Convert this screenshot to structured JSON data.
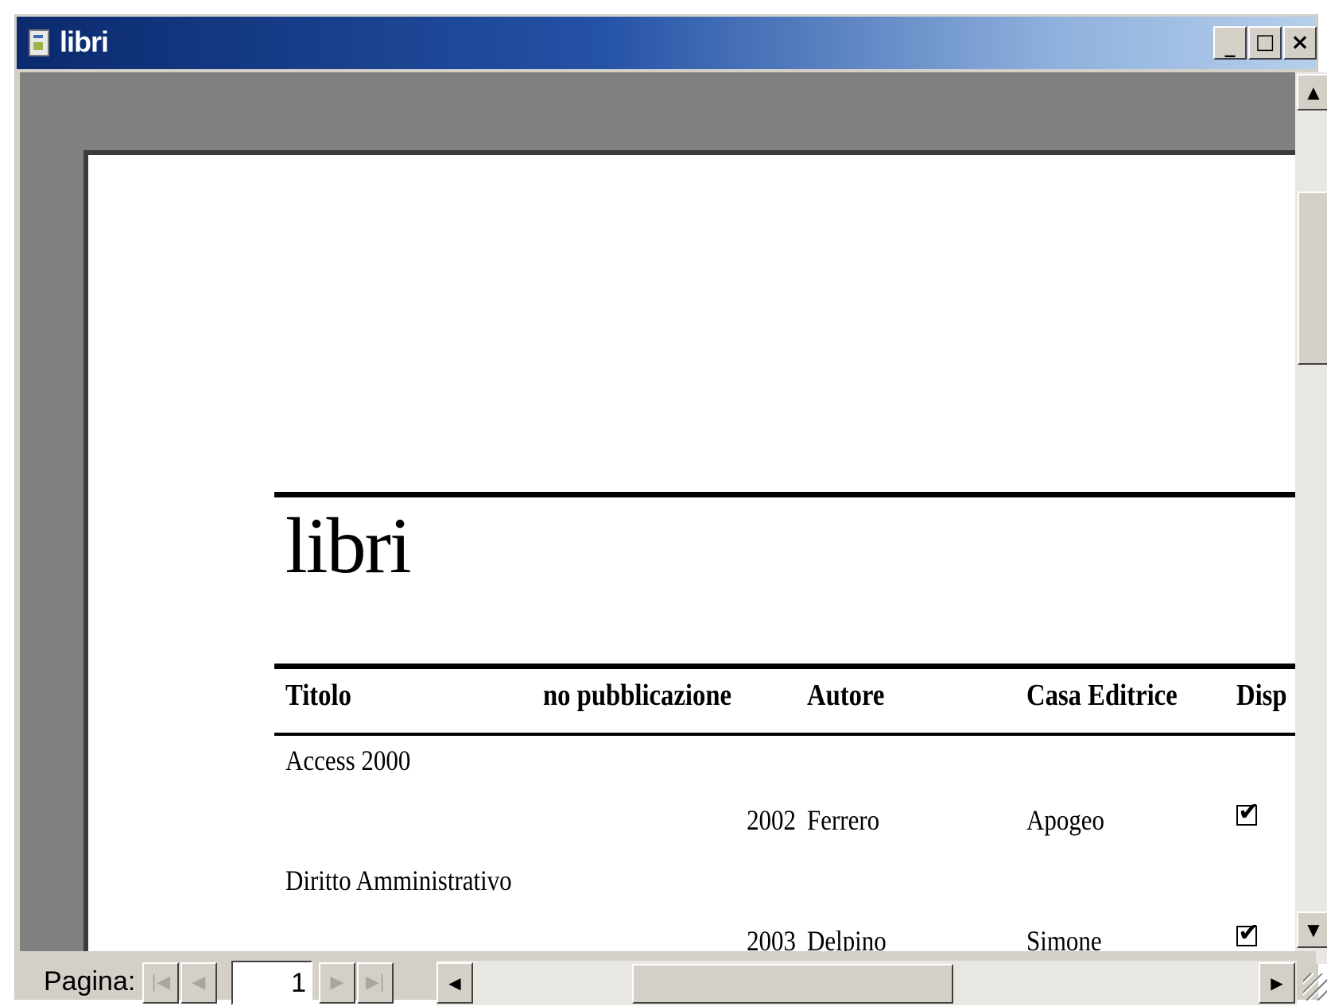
{
  "window": {
    "title": "libri",
    "controls": {
      "minimize": "_",
      "maximize": "□",
      "close": "×"
    }
  },
  "report": {
    "title": "libri",
    "columns": {
      "titolo": "Titolo",
      "anno": "no pubblicazione",
      "autore": "Autore",
      "casa": "Casa Editrice",
      "disp": "Disp"
    },
    "records": [
      {
        "titolo": "Access 2000",
        "anno": "2002",
        "autore": "Ferrero",
        "casa": "Apogeo",
        "disponibile": true
      },
      {
        "titolo": "Diritto Amministrativo",
        "anno": "2003",
        "autore": "Delpino",
        "casa": "Simone",
        "disponibile": true
      }
    ],
    "check_glyph": "✔"
  },
  "navigation": {
    "label": "Pagina:",
    "current_page": "1",
    "first": "|◀",
    "prev": "◀",
    "next": "▶",
    "last": "▶|"
  },
  "scroll": {
    "up": "▲",
    "down": "▼",
    "left": "◀",
    "right": "▶"
  }
}
